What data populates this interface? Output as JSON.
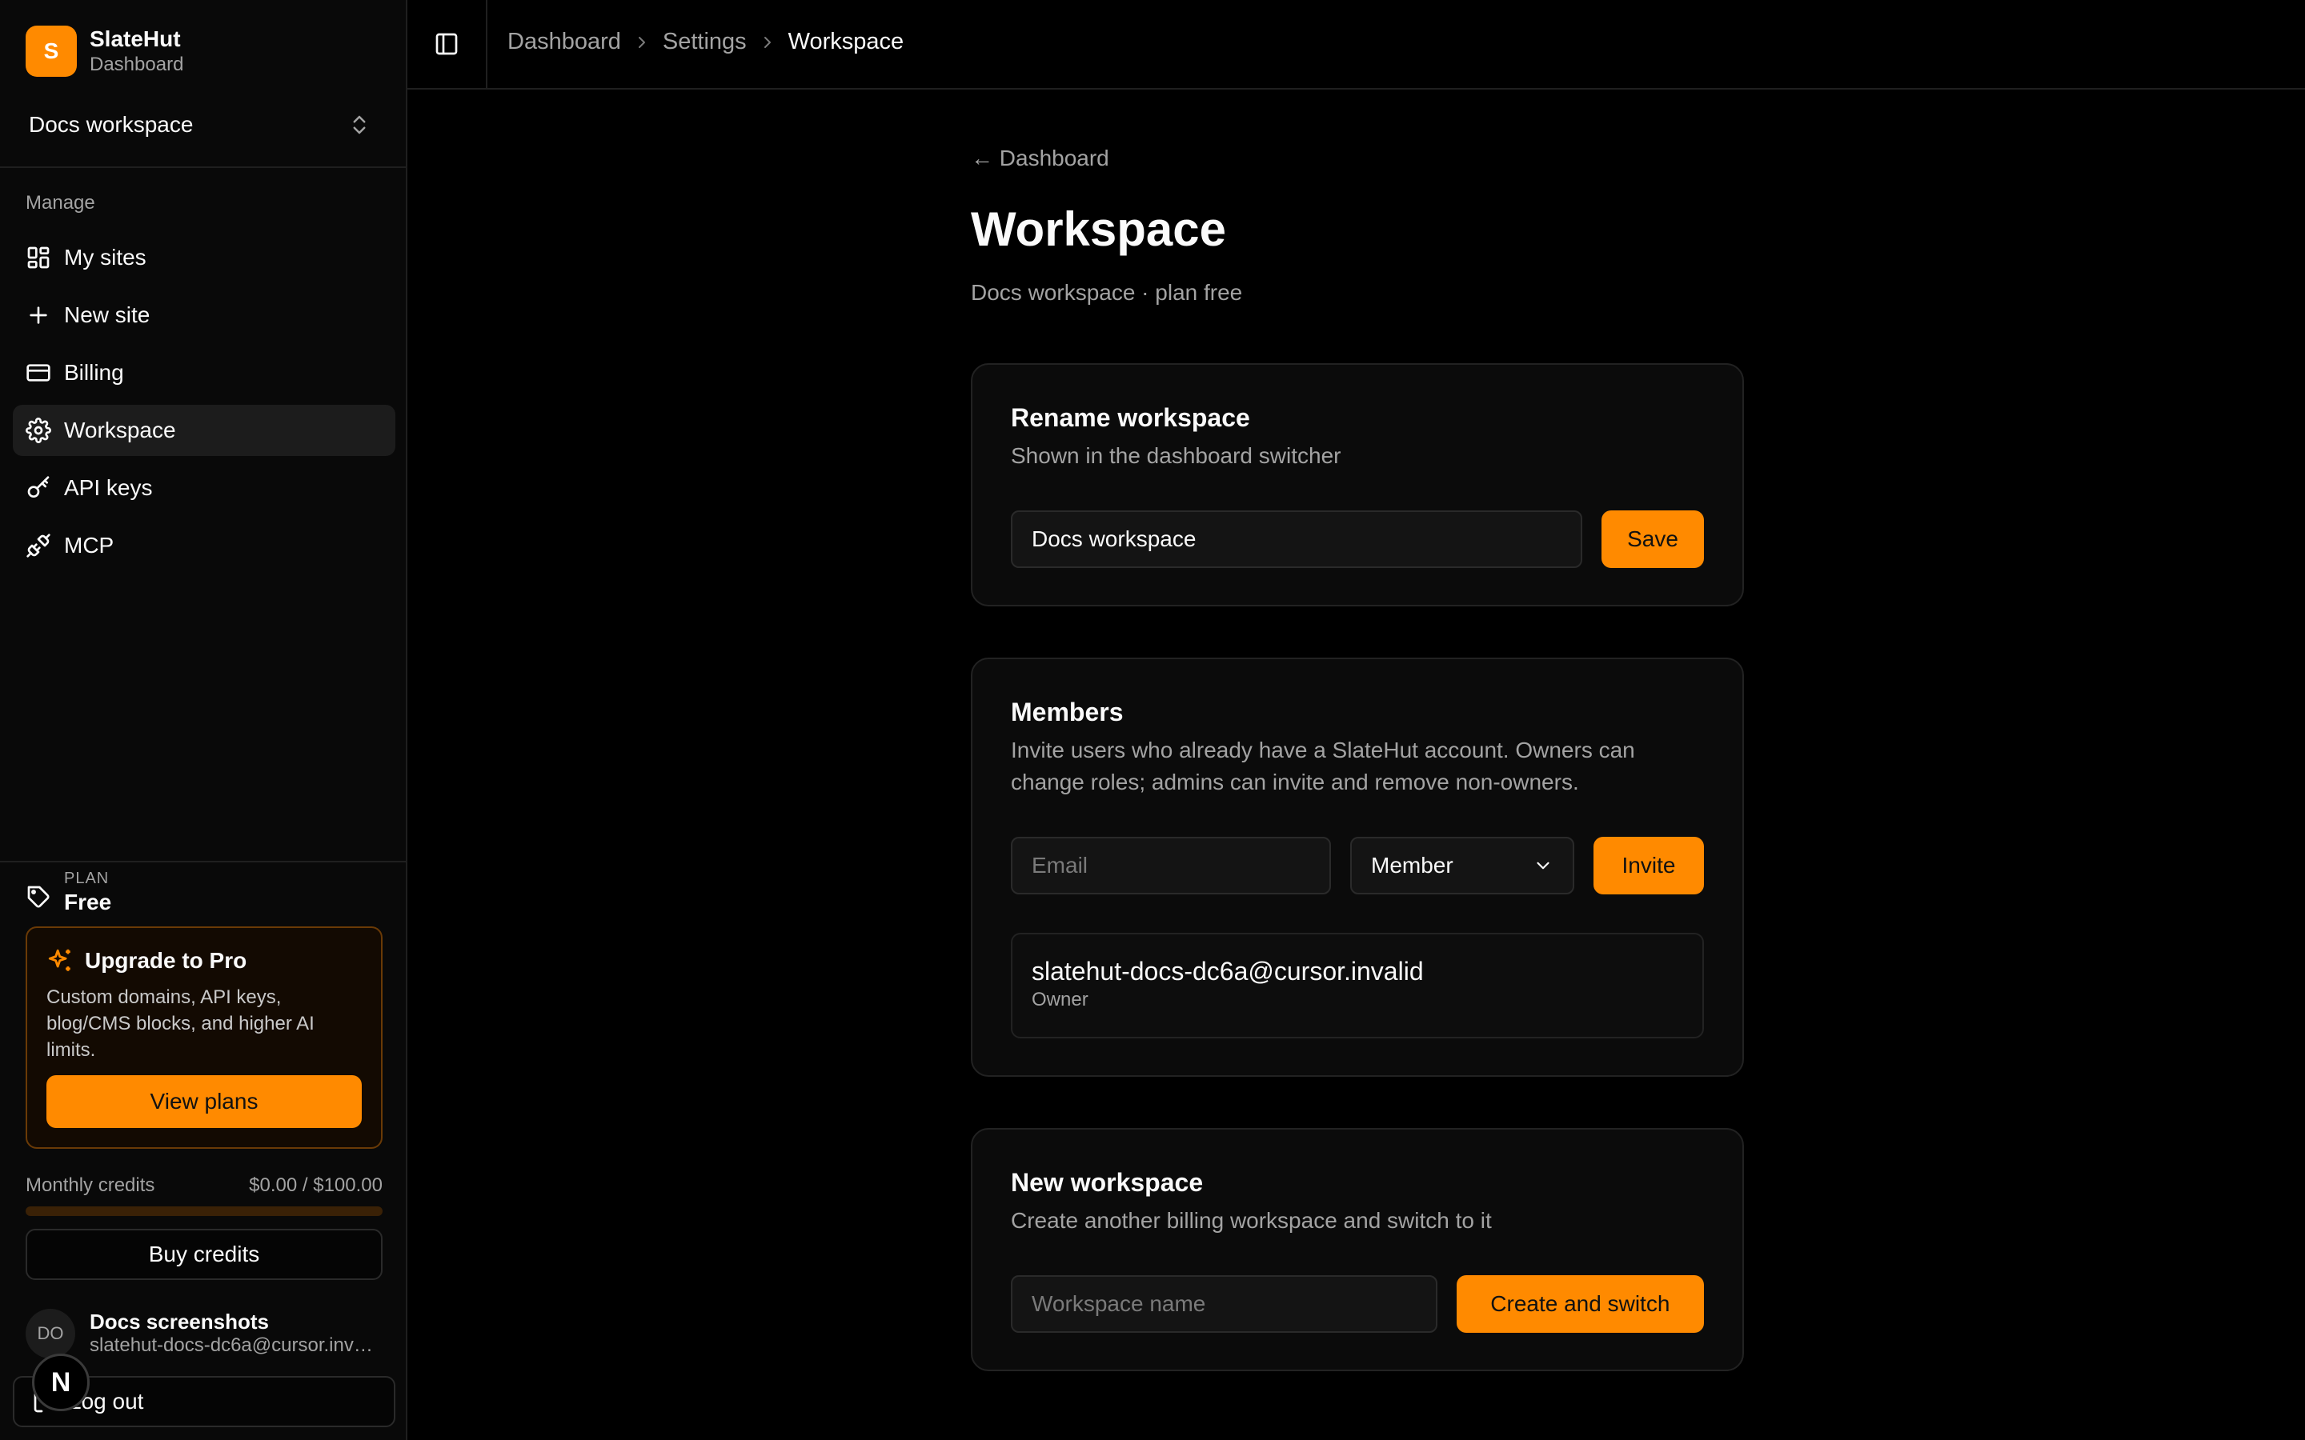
{
  "brand": {
    "logo_letter": "S",
    "name": "SlateHut",
    "subtitle": "Dashboard"
  },
  "workspace_switcher": {
    "label": "Docs workspace"
  },
  "nav": {
    "heading": "Manage",
    "items": [
      {
        "label": "My sites",
        "icon": "grid-icon",
        "active": false
      },
      {
        "label": "New site",
        "icon": "plus-icon",
        "active": false
      },
      {
        "label": "Billing",
        "icon": "credit-card-icon",
        "active": false
      },
      {
        "label": "Workspace",
        "icon": "gear-icon",
        "active": true
      },
      {
        "label": "API keys",
        "icon": "key-icon",
        "active": false
      },
      {
        "label": "MCP",
        "icon": "plug-icon",
        "active": false
      }
    ]
  },
  "plan": {
    "caption": "PLAN",
    "value": "Free"
  },
  "upgrade": {
    "title": "Upgrade to Pro",
    "description": "Custom domains, API keys, blog/CMS blocks, and higher AI limits.",
    "button_label": "View plans"
  },
  "credits": {
    "label": "Monthly credits",
    "value": "$0.00 / $100.00",
    "used_fraction": 0
  },
  "buy_credits_label": "Buy credits",
  "user": {
    "initials": "DO",
    "name": "Docs screenshots",
    "email": "slatehut-docs-dc6a@cursor.invalid"
  },
  "logout_label": "Log out",
  "floating_badge": "N",
  "breadcrumb": [
    "Dashboard",
    "Settings",
    "Workspace"
  ],
  "page": {
    "back_link": "← Dashboard",
    "title": "Workspace",
    "subtitle": "Docs workspace · plan free"
  },
  "rename_card": {
    "title": "Rename workspace",
    "description": "Shown in the dashboard switcher",
    "input_value": "Docs workspace",
    "button_label": "Save"
  },
  "members_card": {
    "title": "Members",
    "description": "Invite users who already have a SlateHut account. Owners can change roles; admins can invite and remove non-owners.",
    "email_placeholder": "Email",
    "role_selected": "Member",
    "button_label": "Invite",
    "members": [
      {
        "email": "slatehut-docs-dc6a@cursor.invalid",
        "role": "Owner"
      }
    ]
  },
  "new_workspace_card": {
    "title": "New workspace",
    "description": "Create another billing workspace and switch to it",
    "name_placeholder": "Workspace name",
    "button_label": "Create and switch"
  },
  "colors": {
    "accent": "#ff8a00",
    "background": "#000000",
    "sidebar": "#090909",
    "card": "#0b0b0b"
  }
}
